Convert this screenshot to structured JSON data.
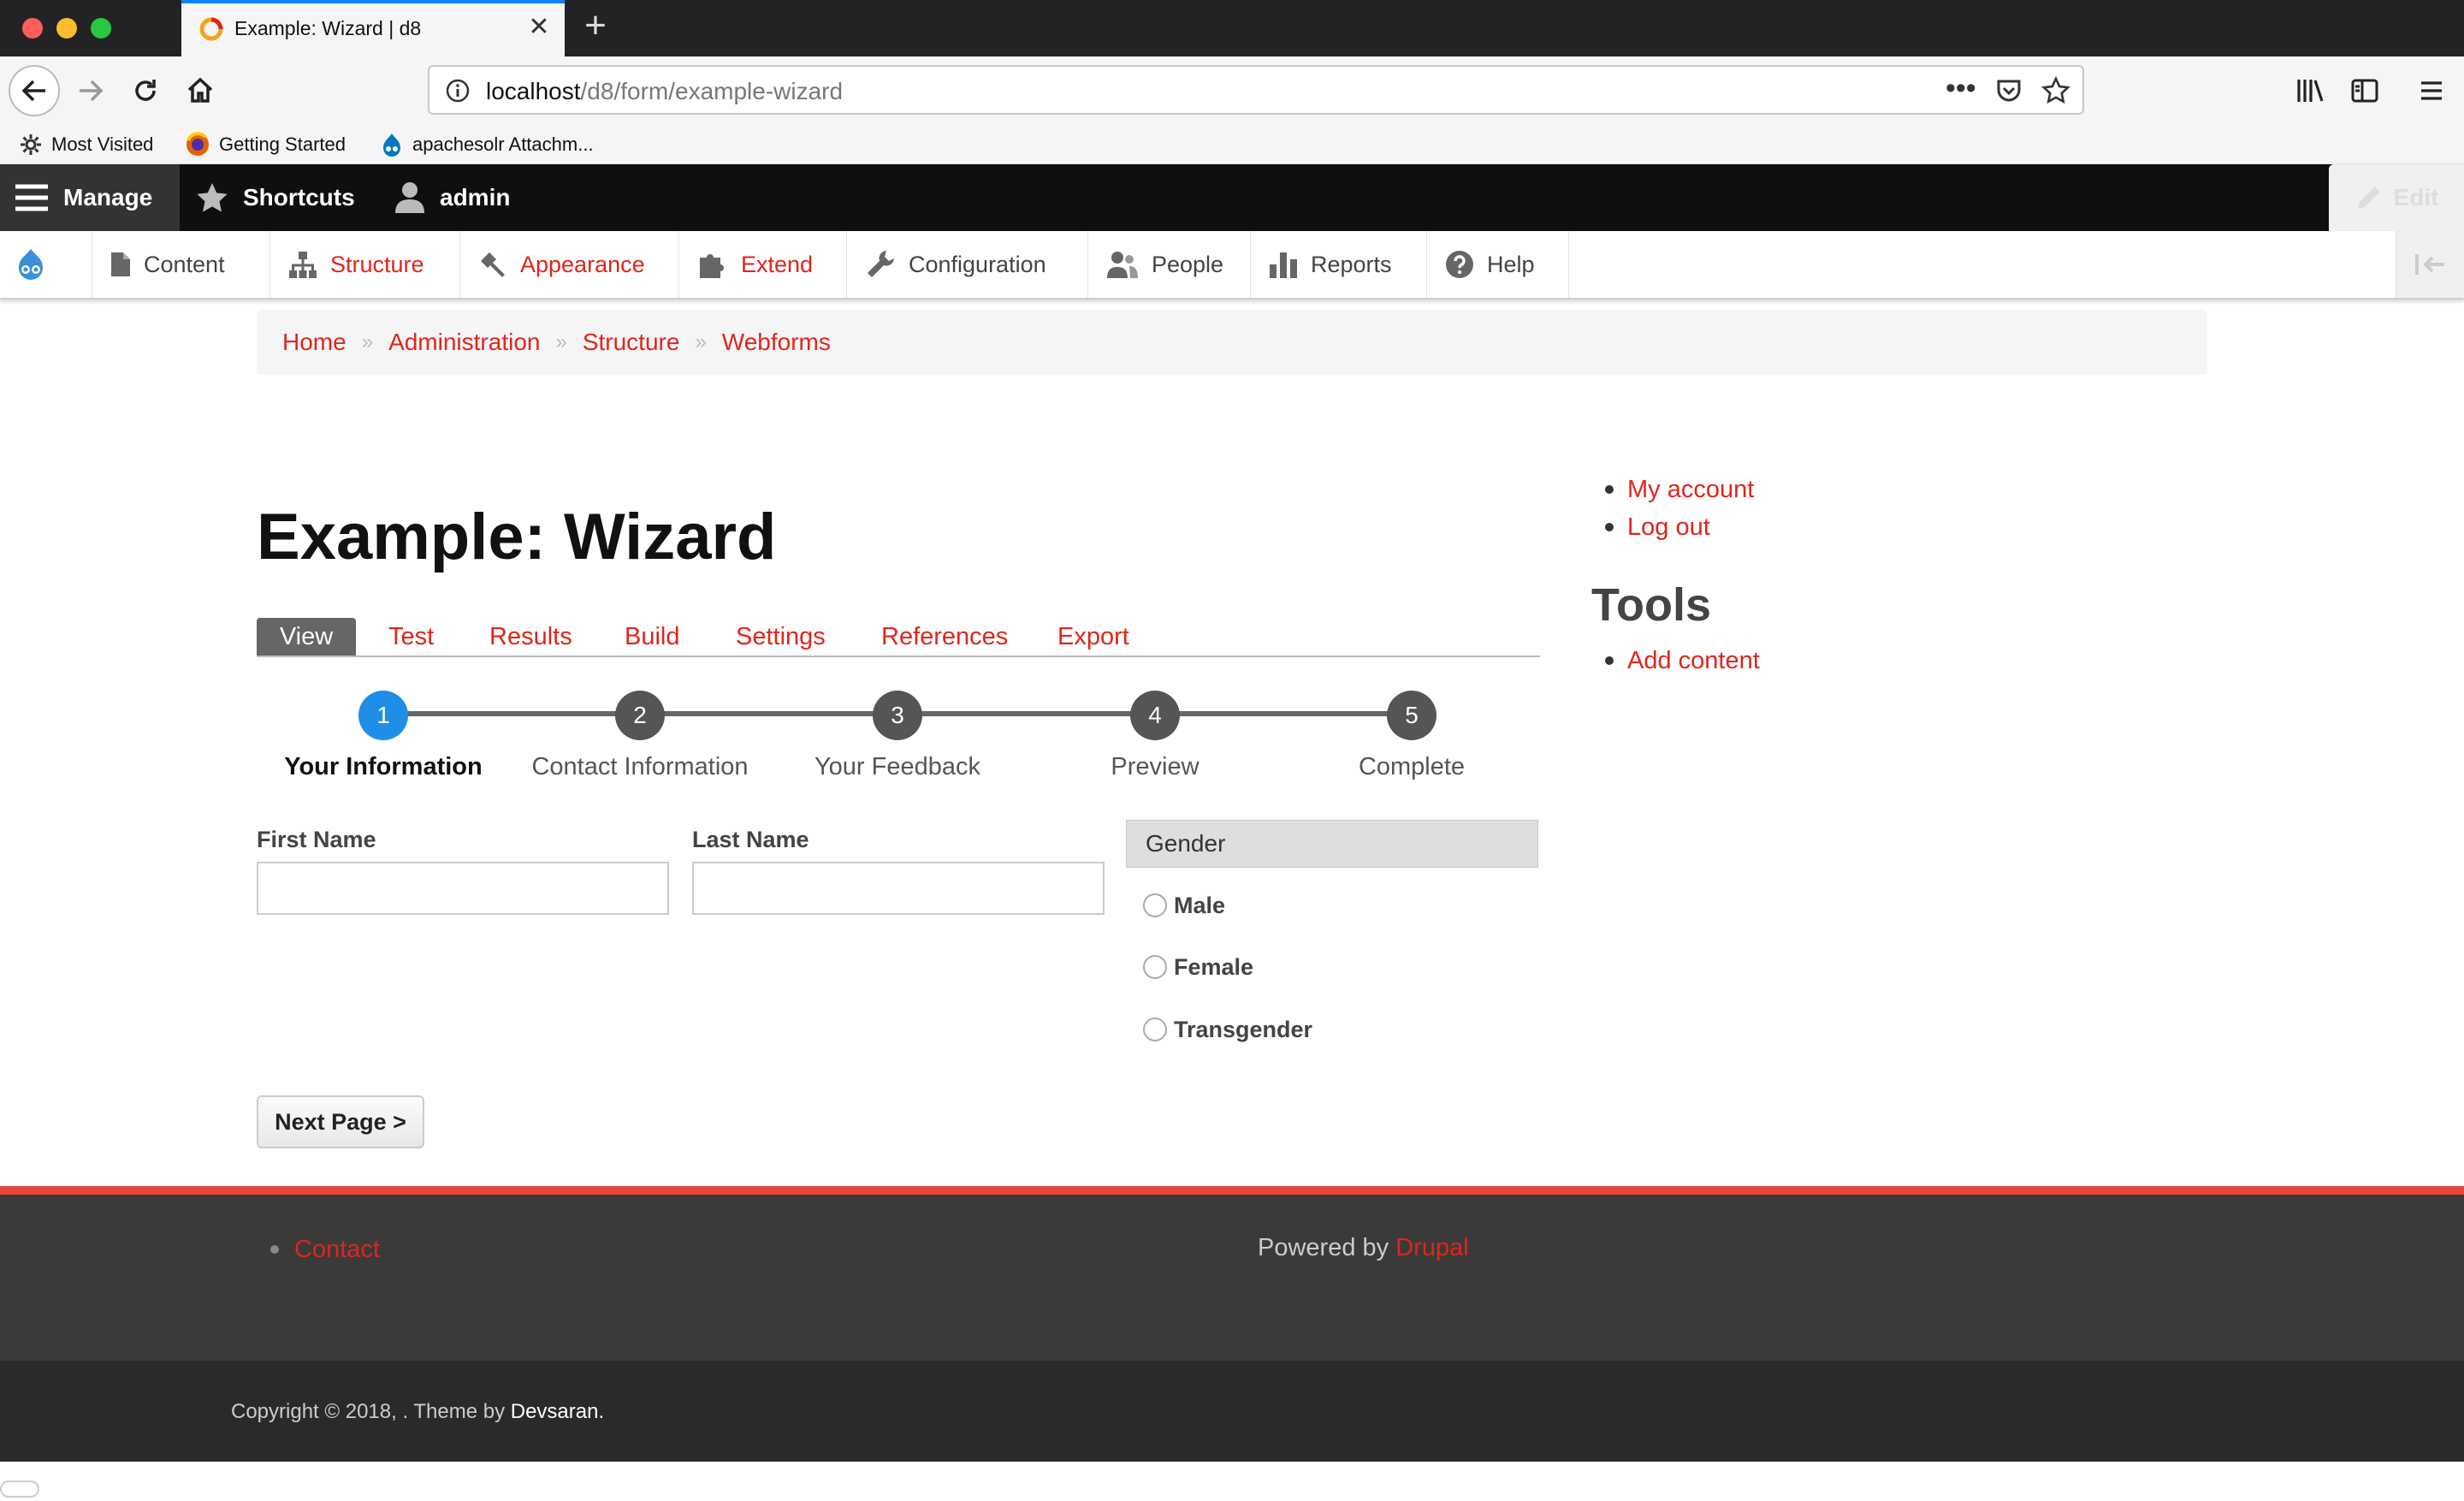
{
  "browser": {
    "tab_title": "Example: Wizard | d8",
    "url_host": "localhost",
    "url_path": "/d8/form/example-wizard",
    "bookmarks": [
      {
        "label": "Most Visited",
        "icon": "gear-icon"
      },
      {
        "label": "Getting Started",
        "icon": "firefox-icon"
      },
      {
        "label": "apachesolr Attachm...",
        "icon": "drupal-icon"
      }
    ]
  },
  "toolbar": {
    "manage": "Manage",
    "shortcuts": "Shortcuts",
    "user": "admin",
    "edit": "Edit",
    "tray": [
      "Content",
      "Structure",
      "Appearance",
      "Extend",
      "Configuration",
      "People",
      "Reports",
      "Help"
    ]
  },
  "breadcrumb": [
    "Home",
    "Administration",
    "Structure",
    "Webforms"
  ],
  "page": {
    "title": "Example: Wizard",
    "tabs": [
      "View",
      "Test",
      "Results",
      "Build",
      "Settings",
      "References",
      "Export"
    ]
  },
  "wizard": {
    "current_step": 1,
    "steps": [
      {
        "number": "1",
        "label": "Your Information"
      },
      {
        "number": "2",
        "label": "Contact Information"
      },
      {
        "number": "3",
        "label": "Your Feedback"
      },
      {
        "number": "4",
        "label": "Preview"
      },
      {
        "number": "5",
        "label": "Complete"
      }
    ]
  },
  "form": {
    "first_name_label": "First Name",
    "first_name_value": "",
    "last_name_label": "Last Name",
    "last_name_value": "",
    "gender_legend": "Gender",
    "gender_options": [
      "Male",
      "Female",
      "Transgender"
    ],
    "next_button": "Next Page >"
  },
  "sidebar": {
    "account_links": [
      "My account",
      "Log out"
    ],
    "tools_heading": "Tools",
    "tools_links": [
      "Add content"
    ]
  },
  "footer": {
    "contact": "Contact",
    "powered_by": "Powered by",
    "powered_link": "Drupal",
    "copyright": "Copyright © 2018, . Theme by",
    "theme_author": "Devsaran."
  },
  "colors": {
    "link": "#e0251b",
    "active_step": "#1f8ee6",
    "footer_accent": "#e8453c"
  }
}
